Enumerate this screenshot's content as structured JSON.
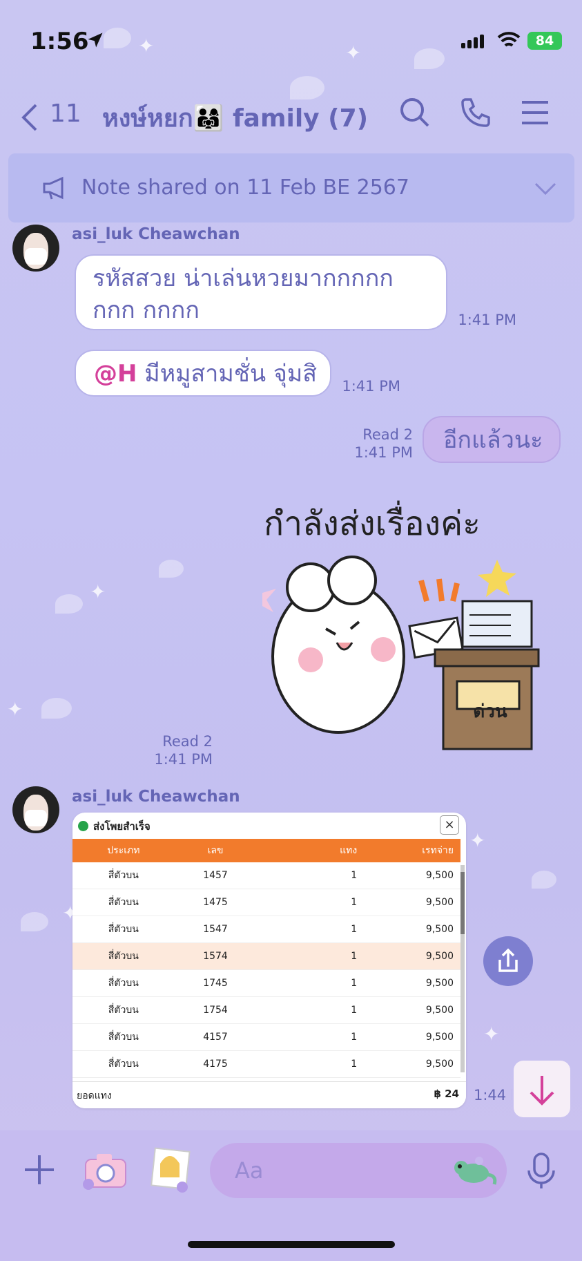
{
  "status_bar": {
    "time": "1:56",
    "battery": "84"
  },
  "nav": {
    "back_count": "11",
    "title": "หงษ์หยก👨‍👩‍👧 family (7)"
  },
  "note_banner": {
    "text": "Note shared on 11 Feb BE 2567"
  },
  "messages": [
    {
      "sender": "asi_luk Cheawchan",
      "text": "รหัสสวย น่าเล่นหวยมากกกกกกกก กกกก",
      "time": "1:41 PM"
    },
    {
      "mention": "@H",
      "text": " มีหมูสามชั่น จุ่มสิ",
      "time": "1:41 PM"
    },
    {
      "mine": true,
      "text": "อีกแล้วนะ",
      "read": "Read 2",
      "time": "1:41 PM"
    },
    {
      "mine": true,
      "sticker_text": "กำลังส่งเรื่องค่ะ",
      "sticker_label": "ด่วน",
      "read": "Read 2",
      "time": "1:41 PM"
    },
    {
      "sender": "asi_luk Cheawchan",
      "time": "1:44 P"
    }
  ],
  "card": {
    "title": "ส่งโพยสำเร็จ",
    "close": "×",
    "headers": [
      "ประเภท",
      "เลข",
      "แทง",
      "เรทจ่าย"
    ],
    "rows": [
      [
        "สี่ตัวบน",
        "1457",
        "1",
        "9,500"
      ],
      [
        "สี่ตัวบน",
        "1475",
        "1",
        "9,500"
      ],
      [
        "สี่ตัวบน",
        "1547",
        "1",
        "9,500"
      ],
      [
        "สี่ตัวบน",
        "1574",
        "1",
        "9,500"
      ],
      [
        "สี่ตัวบน",
        "1745",
        "1",
        "9,500"
      ],
      [
        "สี่ตัวบน",
        "1754",
        "1",
        "9,500"
      ],
      [
        "สี่ตัวบน",
        "4157",
        "1",
        "9,500"
      ],
      [
        "สี่ตัวบน",
        "4175",
        "1",
        "9,500"
      ]
    ],
    "footer_label": "ยอดแทง",
    "footer_value": "฿ 24"
  },
  "input": {
    "placeholder": "Aa"
  },
  "colors": {
    "accent": "#6465b5",
    "mention": "#d4409a",
    "table_header": "#f27b2c"
  }
}
